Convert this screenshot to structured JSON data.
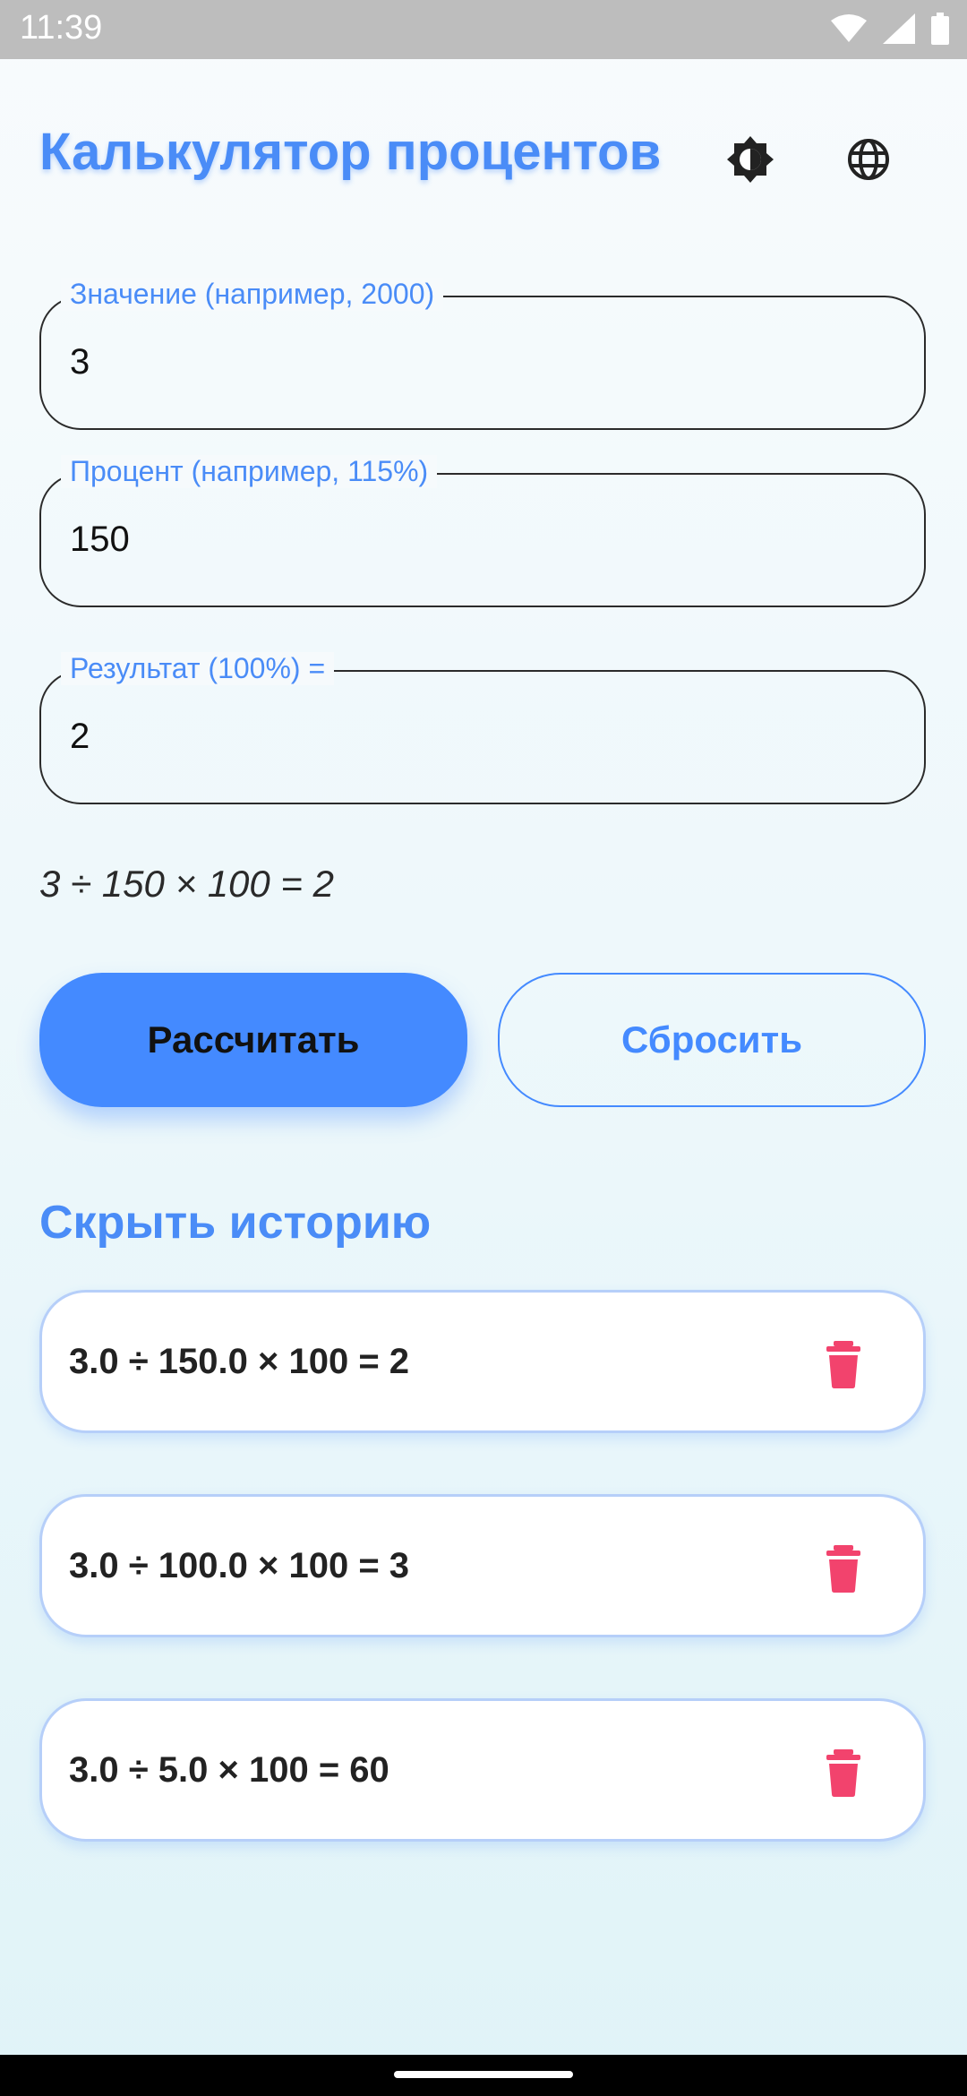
{
  "status": {
    "time": "11:39"
  },
  "header": {
    "title": "Калькулятор процентов"
  },
  "fields": [
    {
      "label": "Значение (например, 2000)",
      "value": "3"
    },
    {
      "label": "Процент (например, 115%)",
      "value": "150"
    },
    {
      "label": "Результат (100%) =",
      "value": "2"
    }
  ],
  "formula": "3 ÷ 150 × 100 = 2",
  "buttons": {
    "calculate": "Рассчитать",
    "reset": "Сбросить"
  },
  "history": {
    "toggle_label": "Скрыть историю",
    "items": [
      {
        "text": "3.0 ÷ 150.0 × 100 = 2"
      },
      {
        "text": "3.0 ÷ 100.0 × 100 = 3"
      },
      {
        "text": "3.0 ÷ 5.0 × 100 = 60"
      }
    ]
  },
  "colors": {
    "accent": "#448aff",
    "title": "#4a8cf7",
    "delete": "#f2436d"
  },
  "icons": [
    "brightness-icon",
    "globe-icon",
    "delete-icon",
    "wifi-icon",
    "signal-icon",
    "battery-icon"
  ]
}
